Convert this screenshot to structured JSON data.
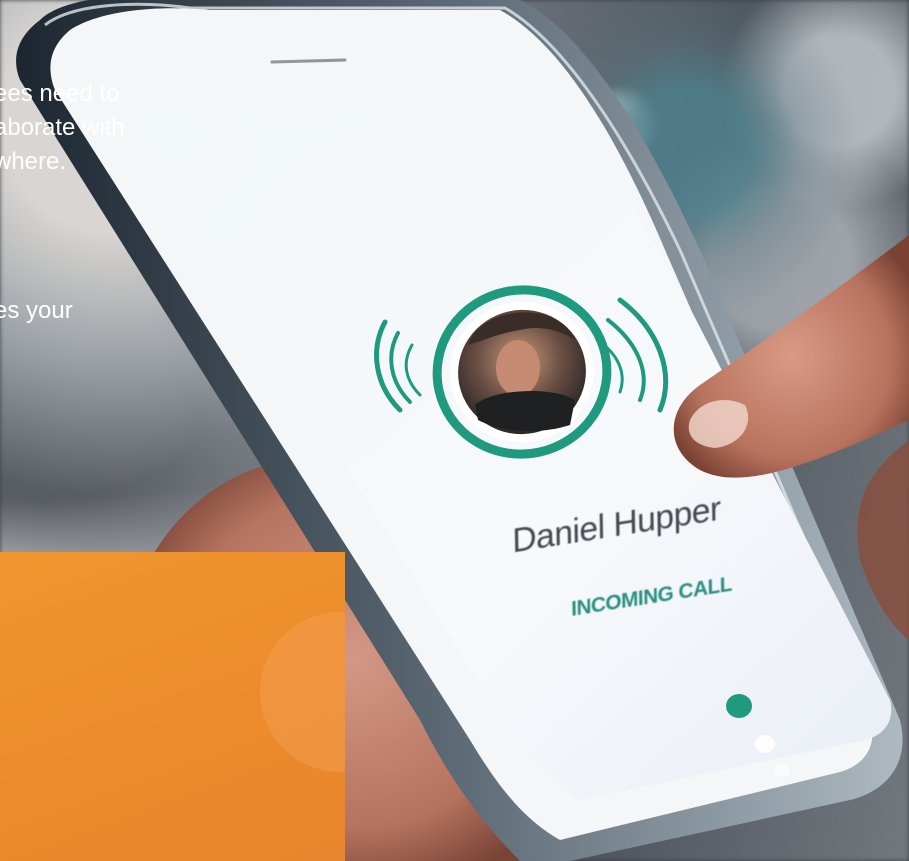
{
  "promo": {
    "lines": "ees need to\naborate with\nwhere.",
    "partial_line": "es your"
  },
  "call_screen": {
    "caller_name": "Daniel Hupper",
    "status": "INCOMING CALL"
  },
  "colors": {
    "accent_teal": "#1f9a7e",
    "overlay_orange": "#ee8f2e"
  }
}
